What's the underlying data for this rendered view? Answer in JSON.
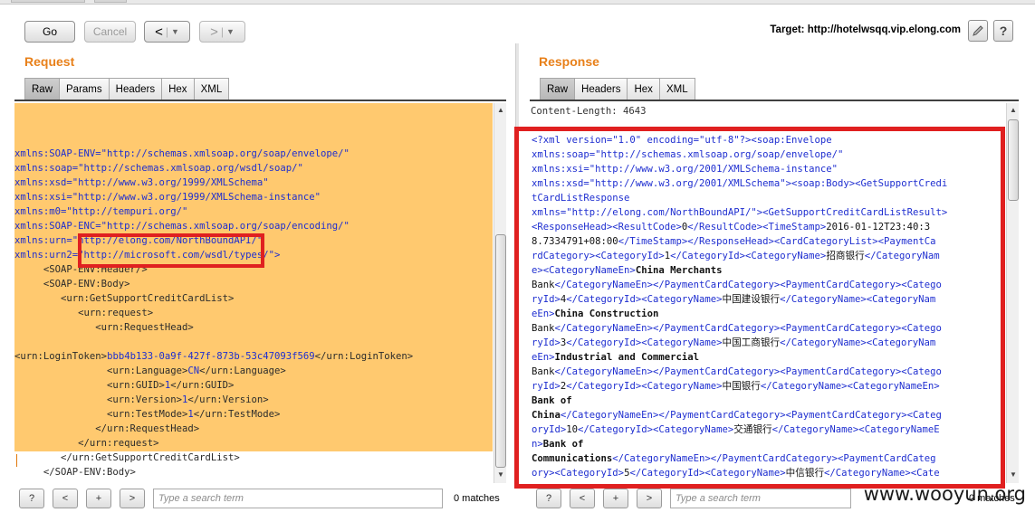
{
  "toolbar": {
    "go_label": "Go",
    "cancel_label": "Cancel",
    "back_label": "<",
    "forward_label": ">",
    "dropdown_glyph": "▼",
    "target_label": "Target: http://hotelwsqq.vip.elong.com",
    "edit_icon": "pencil-icon",
    "help_icon": "help-icon",
    "help_glyph": "?"
  },
  "request": {
    "title": "Request",
    "tabs": [
      "Raw",
      "Params",
      "Headers",
      "Hex",
      "XML"
    ],
    "active_tab": "Raw",
    "lines": [
      [
        {
          "c": "blue",
          "t": "xmlns:SOAP-ENV=\"http://schemas.xmlsoap.org/soap/envelope/\""
        }
      ],
      [
        {
          "c": "blue",
          "t": "xmlns:soap=\"http://schemas.xmlsoap.org/wsdl/soap/\""
        }
      ],
      [
        {
          "c": "blue",
          "t": "xmlns:xsd=\"http://www.w3.org/1999/XMLSchema\""
        }
      ],
      [
        {
          "c": "blue",
          "t": "xmlns:xsi=\"http://www.w3.org/1999/XMLSchema-instance\""
        }
      ],
      [
        {
          "c": "blue",
          "t": "xmlns:m0=\"http://tempuri.org/\""
        }
      ],
      [
        {
          "c": "blue",
          "t": "xmlns:SOAP-ENC=\"http://schemas.xmlsoap.org/soap/encoding/\""
        }
      ],
      [
        {
          "c": "blue",
          "t": "xmlns:urn=\"http://elong.com/NorthBoundAPI/\""
        }
      ],
      [
        {
          "c": "blue",
          "t": "xmlns:urn2=\"http://microsoft.com/wsdl/types/\">"
        }
      ],
      [
        {
          "c": "dark",
          "t": "     <SOAP-ENV:Header/>"
        }
      ],
      [
        {
          "c": "dark",
          "t": "     <SOAP-ENV:Body>"
        }
      ],
      [
        {
          "c": "dark",
          "t": "        <urn:GetSupportCreditCardList>"
        }
      ],
      [
        {
          "c": "dark",
          "t": "           <urn:request>"
        }
      ],
      [
        {
          "c": "dark",
          "t": "              <urn:RequestHead>"
        }
      ],
      [
        {
          "c": "dark",
          "t": ""
        }
      ],
      [
        {
          "c": "dark",
          "t": "<urn:LoginToken>"
        },
        {
          "c": "blue",
          "t": "bbb4b133-0a9f-427f-873b-53c47093f569"
        },
        {
          "c": "dark",
          "t": "</urn:LoginToken>"
        }
      ],
      [
        {
          "c": "dark",
          "t": "                <urn:Language>"
        },
        {
          "c": "blue",
          "t": "CN"
        },
        {
          "c": "dark",
          "t": "</urn:Language>"
        }
      ],
      [
        {
          "c": "dark",
          "t": "                <urn:GUID>"
        },
        {
          "c": "blue",
          "t": "1"
        },
        {
          "c": "dark",
          "t": "</urn:GUID>"
        }
      ],
      [
        {
          "c": "dark",
          "t": "                <urn:Version>"
        },
        {
          "c": "blue",
          "t": "1"
        },
        {
          "c": "dark",
          "t": "</urn:Version>"
        }
      ],
      [
        {
          "c": "dark",
          "t": "                <urn:TestMode>"
        },
        {
          "c": "blue",
          "t": "1"
        },
        {
          "c": "dark",
          "t": "</urn:TestMode>"
        }
      ],
      [
        {
          "c": "dark",
          "t": "              </urn:RequestHead>"
        }
      ],
      [
        {
          "c": "dark",
          "t": "           </urn:request>"
        }
      ],
      [
        {
          "c": "dark",
          "t": "        </urn:GetSupportCreditCardList>"
        }
      ],
      [
        {
          "c": "dark",
          "t": "     </SOAP-ENV:Body>"
        }
      ],
      [
        {
          "c": "dark",
          "t": "</SOAP-ENV:Envelope>"
        }
      ]
    ],
    "search_placeholder": "Type a search term",
    "matches": "0 matches",
    "help_glyph": "?",
    "prev_glyph": "<",
    "add_glyph": "+",
    "next_glyph": ">"
  },
  "response": {
    "title": "Response",
    "tabs": [
      "Raw",
      "Headers",
      "Hex",
      "XML"
    ],
    "active_tab": "Raw",
    "content_length_line": "Content-Length: 4643",
    "lines": [
      [
        {
          "c": "b",
          "t": "<?xml version=\"1.0\" encoding=\"utf-8\"?><soap:Envelope"
        }
      ],
      [
        {
          "c": "b",
          "t": "xmlns:soap=\"http://schemas.xmlsoap.org/soap/envelope/\""
        }
      ],
      [
        {
          "c": "b",
          "t": "xmlns:xsi=\"http://www.w3.org/2001/XMLSchema-instance\""
        }
      ],
      [
        {
          "c": "b",
          "t": "xmlns:xsd=\"http://www.w3.org/2001/XMLSchema\"><soap:Body><GetSupportCredi"
        }
      ],
      [
        {
          "c": "b",
          "t": "tCardListResponse"
        }
      ],
      [
        {
          "c": "b",
          "t": "xmlns=\"http://elong.com/NorthBoundAPI/\"><GetSupportCreditCardListResult>"
        }
      ],
      [
        {
          "c": "b",
          "t": "<ResponseHead><ResultCode>"
        },
        {
          "c": "d",
          "t": "0"
        },
        {
          "c": "b",
          "t": "</ResultCode><TimeStamp>"
        },
        {
          "c": "d",
          "t": "2016-01-12T23:40:3"
        }
      ],
      [
        {
          "c": "d",
          "t": "8.7334791+08:00"
        },
        {
          "c": "b",
          "t": "</TimeStamp></ResponseHead><CardCategoryList><PaymentCa"
        }
      ],
      [
        {
          "c": "b",
          "t": "rdCategory><CategoryId>"
        },
        {
          "c": "d",
          "t": "1"
        },
        {
          "c": "b",
          "t": "</CategoryId><CategoryName>"
        },
        {
          "c": "d",
          "t": "招商银行"
        },
        {
          "c": "b",
          "t": "</CategoryNam"
        }
      ],
      [
        {
          "c": "b",
          "t": "e><CategoryNameEn>"
        },
        {
          "c": "x",
          "t": "China Merchants"
        }
      ],
      [
        {
          "c": "d",
          "t": "Bank"
        },
        {
          "c": "b",
          "t": "</CategoryNameEn></PaymentCardCategory><PaymentCardCategory><Catego"
        }
      ],
      [
        {
          "c": "b",
          "t": "ryId>"
        },
        {
          "c": "d",
          "t": "4"
        },
        {
          "c": "b",
          "t": "</CategoryId><CategoryName>"
        },
        {
          "c": "d",
          "t": "中国建设银行"
        },
        {
          "c": "b",
          "t": "</CategoryName><CategoryNam"
        }
      ],
      [
        {
          "c": "b",
          "t": "eEn>"
        },
        {
          "c": "x",
          "t": "China Construction"
        }
      ],
      [
        {
          "c": "d",
          "t": "Bank"
        },
        {
          "c": "b",
          "t": "</CategoryNameEn></PaymentCardCategory><PaymentCardCategory><Catego"
        }
      ],
      [
        {
          "c": "b",
          "t": "ryId>"
        },
        {
          "c": "d",
          "t": "3"
        },
        {
          "c": "b",
          "t": "</CategoryId><CategoryName>"
        },
        {
          "c": "d",
          "t": "中国工商银行"
        },
        {
          "c": "b",
          "t": "</CategoryName><CategoryNam"
        }
      ],
      [
        {
          "c": "b",
          "t": "eEn>"
        },
        {
          "c": "x",
          "t": "Industrial and Commercial"
        }
      ],
      [
        {
          "c": "d",
          "t": "Bank"
        },
        {
          "c": "b",
          "t": "</CategoryNameEn></PaymentCardCategory><PaymentCardCategory><Catego"
        }
      ],
      [
        {
          "c": "b",
          "t": "ryId>"
        },
        {
          "c": "d",
          "t": "2"
        },
        {
          "c": "b",
          "t": "</CategoryId><CategoryName>"
        },
        {
          "c": "d",
          "t": "中国银行"
        },
        {
          "c": "b",
          "t": "</CategoryName><CategoryNameEn>"
        }
      ],
      [
        {
          "c": "x",
          "t": "Bank of"
        }
      ],
      [
        {
          "c": "x",
          "t": "China"
        },
        {
          "c": "b",
          "t": "</CategoryNameEn></PaymentCardCategory><PaymentCardCategory><Categ"
        }
      ],
      [
        {
          "c": "b",
          "t": "oryId>"
        },
        {
          "c": "d",
          "t": "10"
        },
        {
          "c": "b",
          "t": "</CategoryId><CategoryName>"
        },
        {
          "c": "d",
          "t": "交通银行"
        },
        {
          "c": "b",
          "t": "</CategoryName><CategoryNameE"
        }
      ],
      [
        {
          "c": "b",
          "t": "n>"
        },
        {
          "c": "x",
          "t": "Bank of"
        }
      ],
      [
        {
          "c": "x",
          "t": "Communications"
        },
        {
          "c": "b",
          "t": "</CategoryNameEn></PaymentCardCategory><PaymentCardCateg"
        }
      ],
      [
        {
          "c": "b",
          "t": "ory><CategoryId>"
        },
        {
          "c": "d",
          "t": "5"
        },
        {
          "c": "b",
          "t": "</CategoryId><CategoryName>"
        },
        {
          "c": "d",
          "t": "中信银行"
        },
        {
          "c": "b",
          "t": "</CategoryName><Cate"
        }
      ]
    ],
    "search_placeholder": "Type a search term",
    "matches": "0 matches",
    "help_glyph": "?",
    "prev_glyph": "<",
    "add_glyph": "+",
    "next_glyph": ">"
  },
  "watermark": "www.wooyun.org",
  "colors": {
    "accent": "#e8801a",
    "highlight_bg": "#ffc96f",
    "annotation_red": "#e02020",
    "code_blue": "#1e2ed0"
  }
}
